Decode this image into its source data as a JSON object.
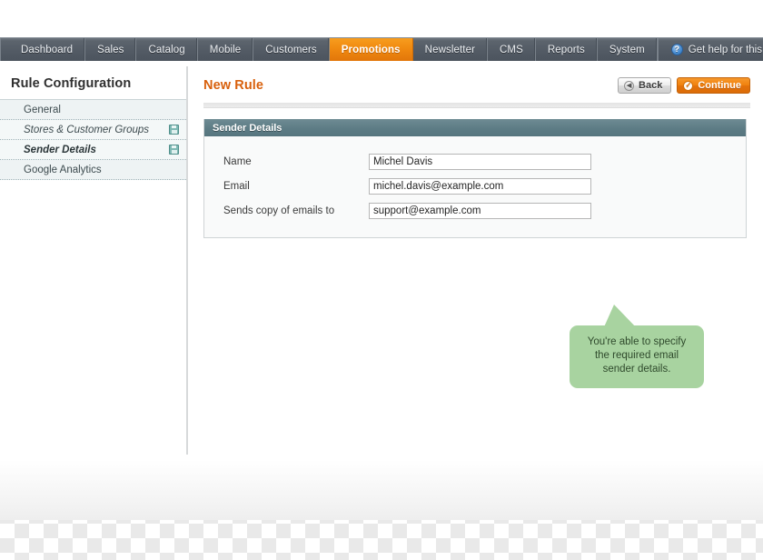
{
  "nav": {
    "items": [
      {
        "label": "Dashboard",
        "active": false
      },
      {
        "label": "Sales",
        "active": false
      },
      {
        "label": "Catalog",
        "active": false
      },
      {
        "label": "Mobile",
        "active": false
      },
      {
        "label": "Customers",
        "active": false
      },
      {
        "label": "Promotions",
        "active": true
      },
      {
        "label": "Newsletter",
        "active": false
      },
      {
        "label": "CMS",
        "active": false
      },
      {
        "label": "Reports",
        "active": false
      },
      {
        "label": "System",
        "active": false
      }
    ],
    "help_label": "Get help for this page",
    "help_icon": "help-circle-icon",
    "active_color": "#ef8a10",
    "bar_color": "#545c66"
  },
  "sidebar": {
    "title": "Rule Configuration",
    "items": [
      {
        "label": "General",
        "italic": false,
        "current": false,
        "has_save_icon": false
      },
      {
        "label": "Stores & Customer Groups",
        "italic": true,
        "current": false,
        "has_save_icon": true
      },
      {
        "label": "Sender Details",
        "italic": true,
        "current": true,
        "has_save_icon": true
      },
      {
        "label": "Google Analytics",
        "italic": false,
        "current": false,
        "has_save_icon": false
      }
    ],
    "save_icon": "save-disk-icon"
  },
  "main": {
    "page_title": "New Rule",
    "page_title_color": "#d8600c",
    "buttons": [
      {
        "label": "Back",
        "style": "grey",
        "icon": "back-arrow-icon"
      },
      {
        "label": "Continue",
        "style": "orange",
        "icon": "check-circle-icon"
      }
    ],
    "panel": {
      "header": "Sender Details",
      "header_color": "#5d7c85",
      "fields": [
        {
          "label": "Name",
          "value": "Michel Davis",
          "placeholder": ""
        },
        {
          "label": "Email",
          "value": "michel.davis@example.com",
          "placeholder": ""
        },
        {
          "label": "Sends copy of emails to",
          "value": "support@example.com",
          "placeholder": ""
        }
      ]
    }
  },
  "callout": {
    "text": "You're able to specify the required email sender details.",
    "color": "#a8d3a0"
  }
}
